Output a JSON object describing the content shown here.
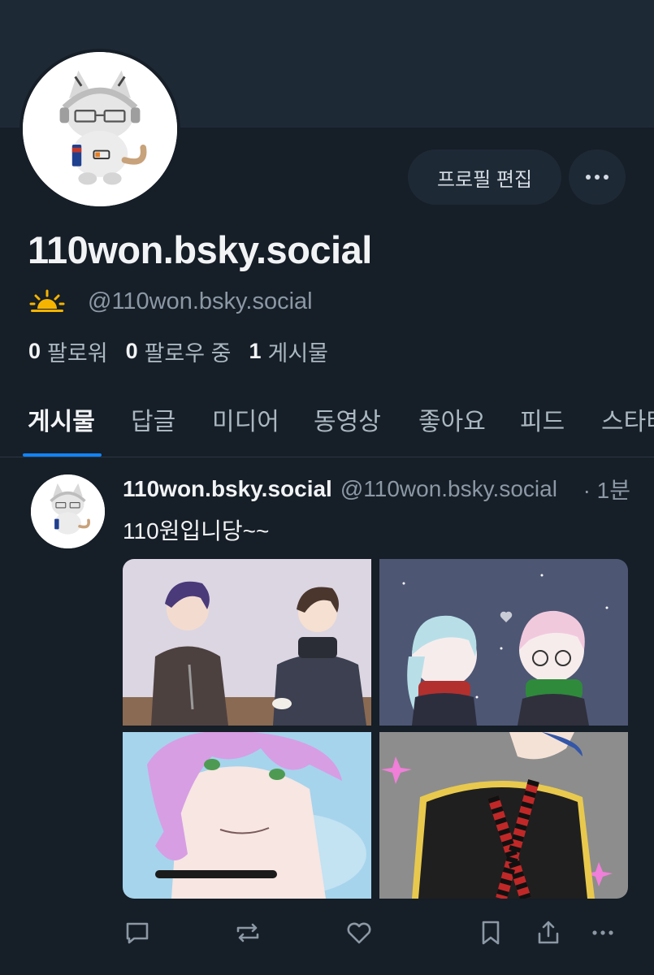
{
  "profile": {
    "display_name": "110won.bsky.social",
    "handle": "@110won.bsky.social",
    "edit_label": "프로필 편집",
    "status_icon": "sun-icon",
    "stats": [
      {
        "count": "0",
        "label": "팔로워"
      },
      {
        "count": "0",
        "label": "팔로우 중"
      },
      {
        "count": "1",
        "label": "게시물"
      }
    ]
  },
  "tabs": [
    {
      "label": "게시물",
      "active": true
    },
    {
      "label": "답글"
    },
    {
      "label": "미디어"
    },
    {
      "label": "동영상"
    },
    {
      "label": "좋아요"
    },
    {
      "label": "피드"
    },
    {
      "label": "스타터"
    }
  ],
  "post": {
    "author_name": "110won.bsky.social",
    "author_handle": "@110won.bsky.social",
    "time": "· 1분",
    "text": "110원입니당~~"
  },
  "actions": [
    "reply-icon",
    "repost-icon",
    "like-icon",
    "bookmark-icon",
    "share-icon",
    "more-icon"
  ],
  "colors": {
    "background": "#161e27",
    "surface": "#1e2936",
    "accent": "#1083fe",
    "muted_text": "#8b98a5",
    "sun": "#f5b400"
  }
}
